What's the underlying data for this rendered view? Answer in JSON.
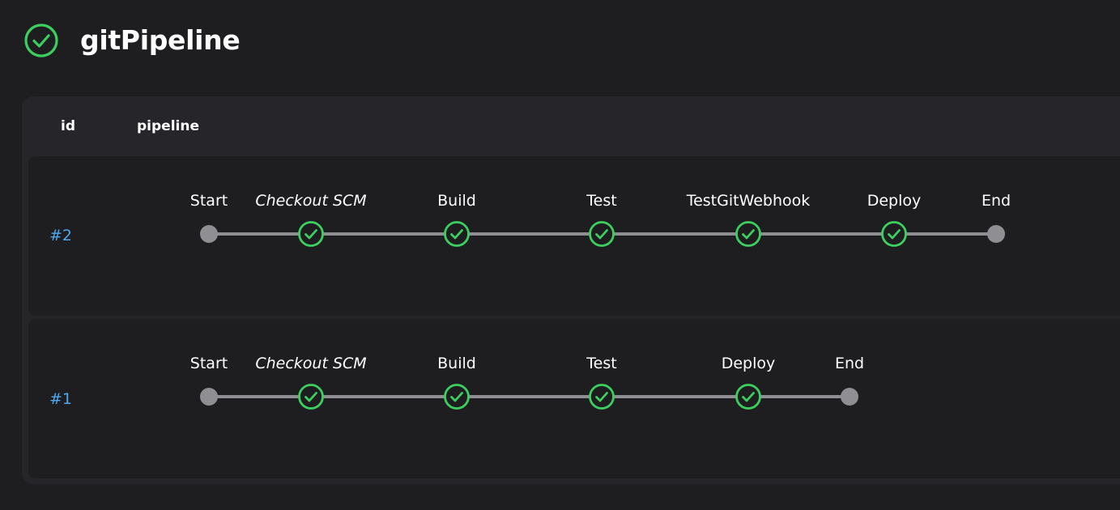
{
  "header": {
    "title": "gitPipeline",
    "status_icon": "success-check-icon",
    "status_color": "#3ccf5f"
  },
  "table": {
    "columns": {
      "id": "id",
      "pipeline": "pipeline"
    }
  },
  "runs": [
    {
      "id": "#2",
      "stages": [
        {
          "label": "Start",
          "status": "node",
          "italic": false
        },
        {
          "label": "Checkout SCM",
          "status": "success",
          "italic": true
        },
        {
          "label": "Build",
          "status": "success",
          "italic": false
        },
        {
          "label": "Test",
          "status": "success",
          "italic": false
        },
        {
          "label": "TestGitWebhook",
          "status": "success",
          "italic": false
        },
        {
          "label": "Deploy",
          "status": "success",
          "italic": false
        },
        {
          "label": "End",
          "status": "node",
          "italic": false
        }
      ]
    },
    {
      "id": "#1",
      "stages": [
        {
          "label": "Start",
          "status": "node",
          "italic": false
        },
        {
          "label": "Checkout SCM",
          "status": "success",
          "italic": true
        },
        {
          "label": "Build",
          "status": "success",
          "italic": false
        },
        {
          "label": "Test",
          "status": "success",
          "italic": false
        },
        {
          "label": "Deploy",
          "status": "success",
          "italic": false
        },
        {
          "label": "End",
          "status": "node",
          "italic": false
        }
      ]
    }
  ],
  "colors": {
    "background": "#1e1e21",
    "card": "#26262a",
    "link": "#4ea7ee",
    "success": "#3ccf5f",
    "node": "#8f8f93"
  }
}
